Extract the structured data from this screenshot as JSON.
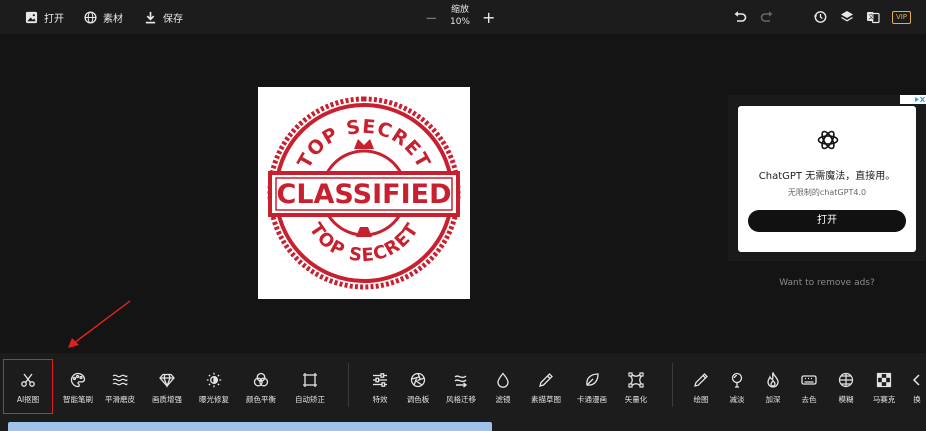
{
  "topbar": {
    "open_label": "打开",
    "assets_label": "素材",
    "save_label": "保存",
    "zoom_label": "缩放",
    "zoom_value": "10%",
    "zoom_minus": "−",
    "zoom_plus": "+",
    "vip_label": "VIP"
  },
  "canvas": {
    "stamp": {
      "top_text": "TOP SECRET",
      "center_text": "CLASSIFIED",
      "bottom_text": "TOP SECRET",
      "color": "#c8202e"
    }
  },
  "ad": {
    "title": "ChatGPT 无需魔法，直接用。",
    "subtitle": "无限制的chatGPT4.0",
    "button": "打开",
    "remove_link": "Want to remove ads?"
  },
  "tools": [
    {
      "label": "AI抠图",
      "icon": "scissors-icon"
    },
    {
      "label": "智能笔刷",
      "icon": "palette-icon"
    },
    {
      "label": "平滑磨皮",
      "icon": "waves-icon"
    },
    {
      "label": "画质增强",
      "icon": "diamond-icon"
    },
    {
      "label": "曝光修复",
      "icon": "brightness-icon"
    },
    {
      "label": "颜色平衡",
      "icon": "color-circles-icon"
    },
    {
      "label": "自动矫正",
      "icon": "crop-frame-icon"
    },
    {
      "label": "特效",
      "icon": "sliders-icon"
    },
    {
      "label": "调色板",
      "icon": "aperture-icon"
    },
    {
      "label": "风格迁移",
      "icon": "style-transfer-icon"
    },
    {
      "label": "滤镜",
      "icon": "drop-icon"
    },
    {
      "label": "素描草图",
      "icon": "pencil-sketch-icon"
    },
    {
      "label": "卡通漫画",
      "icon": "leaf-icon"
    },
    {
      "label": "矢量化",
      "icon": "vector-nodes-icon"
    },
    {
      "label": "绘图",
      "icon": "pen-icon"
    },
    {
      "label": "减淡",
      "icon": "dodge-icon"
    },
    {
      "label": "加深",
      "icon": "flame-icon"
    },
    {
      "label": "去色",
      "icon": "desaturate-icon"
    },
    {
      "label": "模糊",
      "icon": "blur-icon"
    },
    {
      "label": "马赛克",
      "icon": "mosaic-icon"
    },
    {
      "label": "换",
      "icon": "chevron-left-icon"
    }
  ],
  "progress": {
    "fraction": 0.52
  },
  "colors": {
    "highlight": "#e02020",
    "progress": "#9fc3ea",
    "vip": "#e0b050"
  }
}
